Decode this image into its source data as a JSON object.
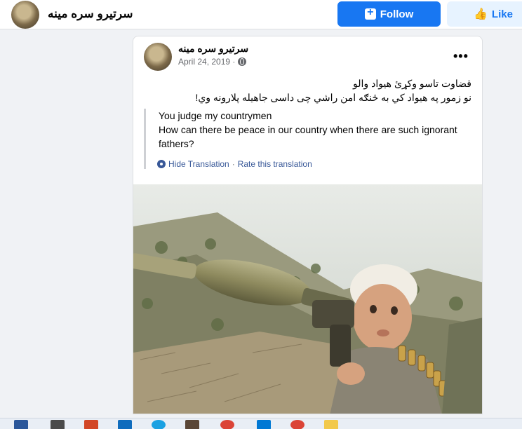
{
  "header": {
    "page_name": "سرتیرو سره مینه",
    "follow_label": "Follow",
    "like_label": "Like"
  },
  "post": {
    "author": "سرتیرو سره مینه",
    "date": "April 24, 2019 · ",
    "original_line1": "قضاوت تاسو وکړئ هیواد والو",
    "original_line2": "نو زمور په هیواد کي به څنګه امن راشي چی داسی جاهیله پلارونه وي!",
    "translation_line1": "You judge my countrymen",
    "translation_line2": "How can there be peace in our country when there are such ignorant fathers?",
    "hide_translation": "Hide Translation",
    "separator": "·",
    "rate_translation": "Rate this translation"
  },
  "icons": {
    "follow": "add-page-icon",
    "like": "thumbs-up-icon",
    "privacy": "globe-icon",
    "settings": "gear-icon",
    "more": "more-horizontal-icon"
  },
  "colors": {
    "brand_blue": "#1877f2",
    "link_blue": "#385898",
    "background": "#f0f2f5"
  },
  "taskbar": {
    "apps": [
      "word-icon",
      "app-icon",
      "powerpoint-icon",
      "mail-icon",
      "edge-icon",
      "briefcase-icon",
      "chrome-icon",
      "store-icon",
      "chrome-icon",
      "folder-icon"
    ]
  }
}
